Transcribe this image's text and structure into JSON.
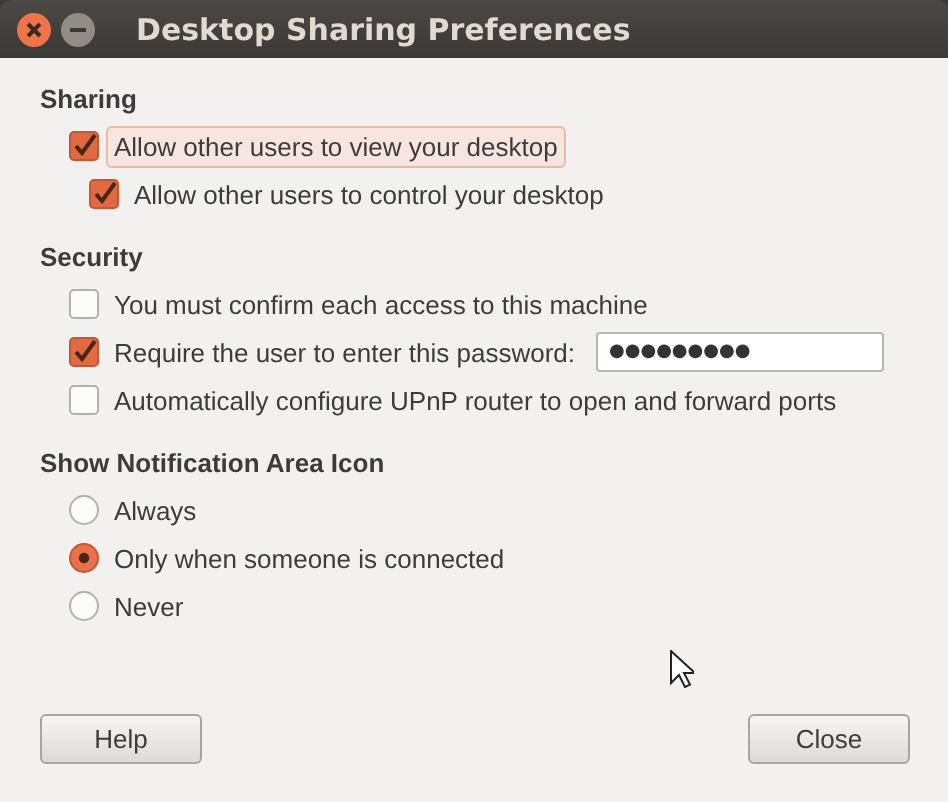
{
  "window": {
    "title": "Desktop Sharing Preferences"
  },
  "sections": [
    {
      "heading": "Sharing",
      "items": [
        {
          "kind": "checkbox",
          "label": "Allow other users to view your desktop",
          "checked": true,
          "focused": true,
          "children": [
            {
              "kind": "checkbox",
              "label": "Allow other users to control your desktop",
              "checked": true,
              "focused": false
            }
          ]
        }
      ]
    },
    {
      "heading": "Security",
      "items": [
        {
          "kind": "checkbox",
          "label": "You must confirm each access to this machine",
          "checked": false,
          "focused": false
        },
        {
          "kind": "checkbox",
          "label": "Require the user to enter this password:",
          "checked": true,
          "focused": false,
          "password": "●●●●●●●●●"
        },
        {
          "kind": "checkbox",
          "label": "Automatically configure UPnP router to open and forward ports",
          "checked": false,
          "focused": false
        }
      ]
    },
    {
      "heading": "Show Notification Area Icon",
      "items": [
        {
          "kind": "radio",
          "label": "Always",
          "selected": false
        },
        {
          "kind": "radio",
          "label": "Only when someone is connected",
          "selected": true
        },
        {
          "kind": "radio",
          "label": "Never",
          "selected": false
        }
      ]
    }
  ],
  "buttons": [
    "Help",
    "Close"
  ]
}
